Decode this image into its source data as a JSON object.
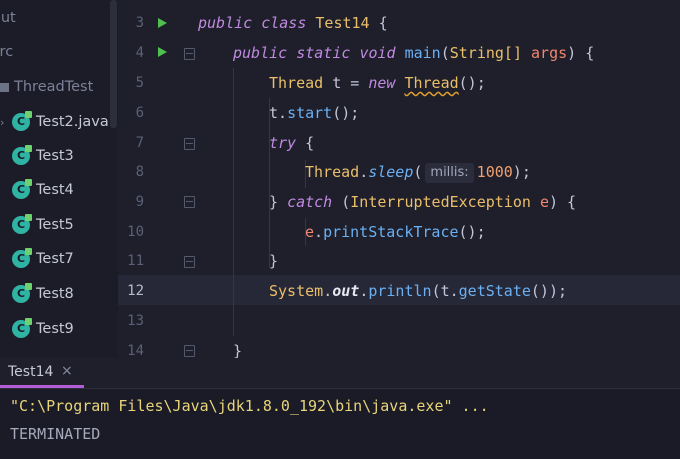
{
  "sidebar": {
    "items": [
      {
        "label": "out"
      },
      {
        "label": "src"
      },
      {
        "label": "ThreadTest"
      },
      {
        "label": "Test2.java"
      },
      {
        "label": "Test3"
      },
      {
        "label": "Test4"
      },
      {
        "label": "Test5"
      },
      {
        "label": "Test7"
      },
      {
        "label": "Test8"
      },
      {
        "label": "Test9"
      }
    ]
  },
  "editor": {
    "lines": [
      {
        "no": "3"
      },
      {
        "no": "4"
      },
      {
        "no": "5"
      },
      {
        "no": "6"
      },
      {
        "no": "7"
      },
      {
        "no": "8"
      },
      {
        "no": "9"
      },
      {
        "no": "10"
      },
      {
        "no": "11"
      },
      {
        "no": "12"
      },
      {
        "no": "13"
      },
      {
        "no": "14"
      }
    ],
    "tokens": {
      "public": "public",
      "class": "class",
      "classname": "Test14",
      "brace_open": " {",
      "static": "static",
      "void": "void",
      "main": "main",
      "string_arr": "String[]",
      "args": "args",
      "main_tail": ") {",
      "thread_type": "Thread",
      "t_decl": " t = ",
      "new": "new",
      "thread_ctor": "Thread",
      "ctor_tail": "();",
      "t_var": "t",
      "start": "start",
      "start_tail": "();",
      "try": "try",
      "try_brace": " {",
      "thread_cls2": "Thread",
      "sleep": "sleep",
      "hint_millis": "millis:",
      "sleep_arg": "1000",
      "sleep_tail": ");",
      "close_brace": "} ",
      "catch": "catch",
      "exc": "InterruptedException",
      "e_param": "e",
      "catch_tail": ") {",
      "e_var": "e",
      "print_stack": "printStackTrace",
      "pst_tail": "();",
      "close_brace2": "}",
      "system": "System",
      "out": "out",
      "println": "println",
      "t_arg": "t",
      "get_state": "getState",
      "println_tail": "());",
      "close_brace3": "}"
    }
  },
  "run_panel": {
    "tab_label": "Test14",
    "close_glyph": "×",
    "command": "\"C:\\Program Files\\Java\\jdk1.8.0_192\\bin\\java.exe\" ...",
    "output": "TERMINATED"
  },
  "colors": {
    "keyword": "#c08ae0",
    "class": "#ebbf6a",
    "method": "#6ab0f3",
    "number": "#f0a070",
    "command_text": "#e8d47a",
    "output_text": "#a6a9bb",
    "tab_underline": "#b25cd6",
    "run_icon": "#4fc04f"
  }
}
